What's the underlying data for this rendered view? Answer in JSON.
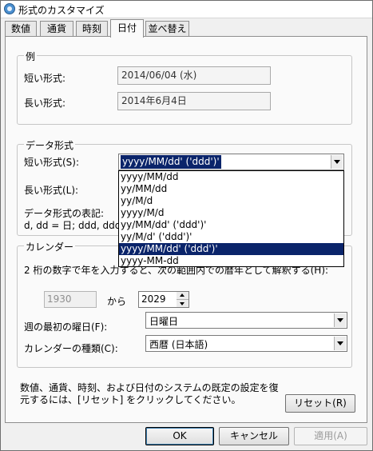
{
  "window": {
    "title": "形式のカスタマイズ"
  },
  "tabs": [
    {
      "label": "数値"
    },
    {
      "label": "通貨"
    },
    {
      "label": "時刻"
    },
    {
      "label": "日付"
    },
    {
      "label": "並べ替え"
    }
  ],
  "example": {
    "group_title": "例",
    "short_label": "短い形式:",
    "short_value": "2014/06/04 (水)",
    "long_label": "長い形式:",
    "long_value": "2014年6月4日"
  },
  "date_format": {
    "group_title": "データ形式",
    "short_label": "短い形式(S):",
    "short_selected": "yyyy/MM/dd' ('ddd')'",
    "long_label": "長い形式(L):",
    "notation_label": "データ形式の表記:",
    "notation_text": "d, dd = 日;  ddd, ddd",
    "options": [
      "yyyy/MM/dd",
      "yy/MM/dd",
      "yy/M/d",
      "yyyy/M/d",
      "yy/MM/dd' ('ddd')'",
      "yy/M/d' ('ddd')'",
      "yyyy/MM/dd' ('ddd')'",
      "yyyy-MM-dd"
    ],
    "highlighted_option": "yyyy/MM/dd' ('ddd')'"
  },
  "calendar": {
    "group_title": "カレンダー",
    "description": "2 桁の数字で年を入力すると、次の範囲内での暦年として解釈する(H):",
    "from_year": "1930",
    "from_text": "から",
    "to_year": "2029",
    "first_day_label": "週の最初の曜日(F):",
    "first_day_value": "日曜日",
    "calendar_type_label": "カレンダーの種類(C):",
    "calendar_type_value": "西暦 (日本語)"
  },
  "reset": {
    "info_text": "数値、通貨、時刻、および日付のシステムの既定の設定を復元するには、[リセット] をクリックしてください。",
    "button_label": "リセット(R)"
  },
  "footer": {
    "ok_label": "OK",
    "cancel_label": "キャンセル",
    "apply_label": "適用(A)"
  }
}
